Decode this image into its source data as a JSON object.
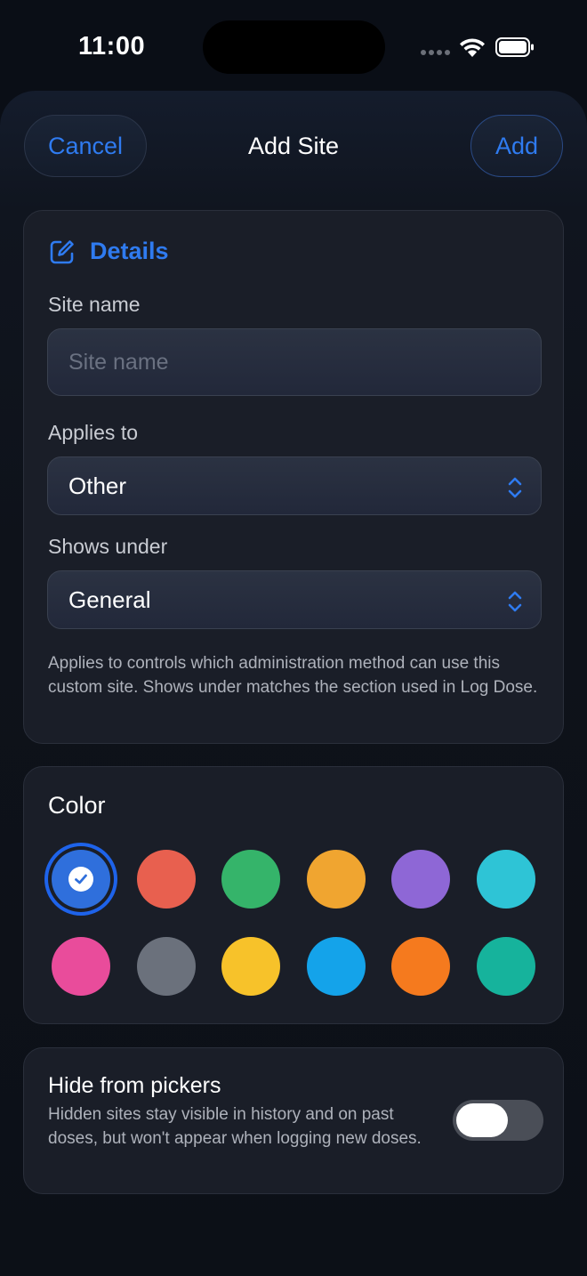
{
  "status_bar": {
    "time": "11:00"
  },
  "nav": {
    "cancel_label": "Cancel",
    "title": "Add Site",
    "add_label": "Add"
  },
  "details": {
    "section_title": "Details",
    "site_name_label": "Site name",
    "site_name_placeholder": "Site name",
    "site_name_value": "",
    "applies_to_label": "Applies to",
    "applies_to_value": "Other",
    "shows_under_label": "Shows under",
    "shows_under_value": "General",
    "help_text": "Applies to controls which administration method can use this custom site. Shows under matches the section used in Log Dose."
  },
  "color": {
    "title": "Color",
    "selected_index": 0,
    "swatches": [
      "#2f6fdc",
      "#e8604f",
      "#35b46a",
      "#f0a530",
      "#8e67d6",
      "#2ec4d6",
      "#e94c9b",
      "#6b717c",
      "#f7c22a",
      "#14a3ea",
      "#f57a1e",
      "#16b39c"
    ]
  },
  "hide": {
    "title": "Hide from pickers",
    "description": "Hidden sites stay visible in history and on past doses, but won't appear when logging new doses.",
    "enabled": false
  },
  "colors": {
    "accent": "#2f7bf0",
    "card_bg": "#1a1e28",
    "screen_bg": "#0a0e16"
  }
}
